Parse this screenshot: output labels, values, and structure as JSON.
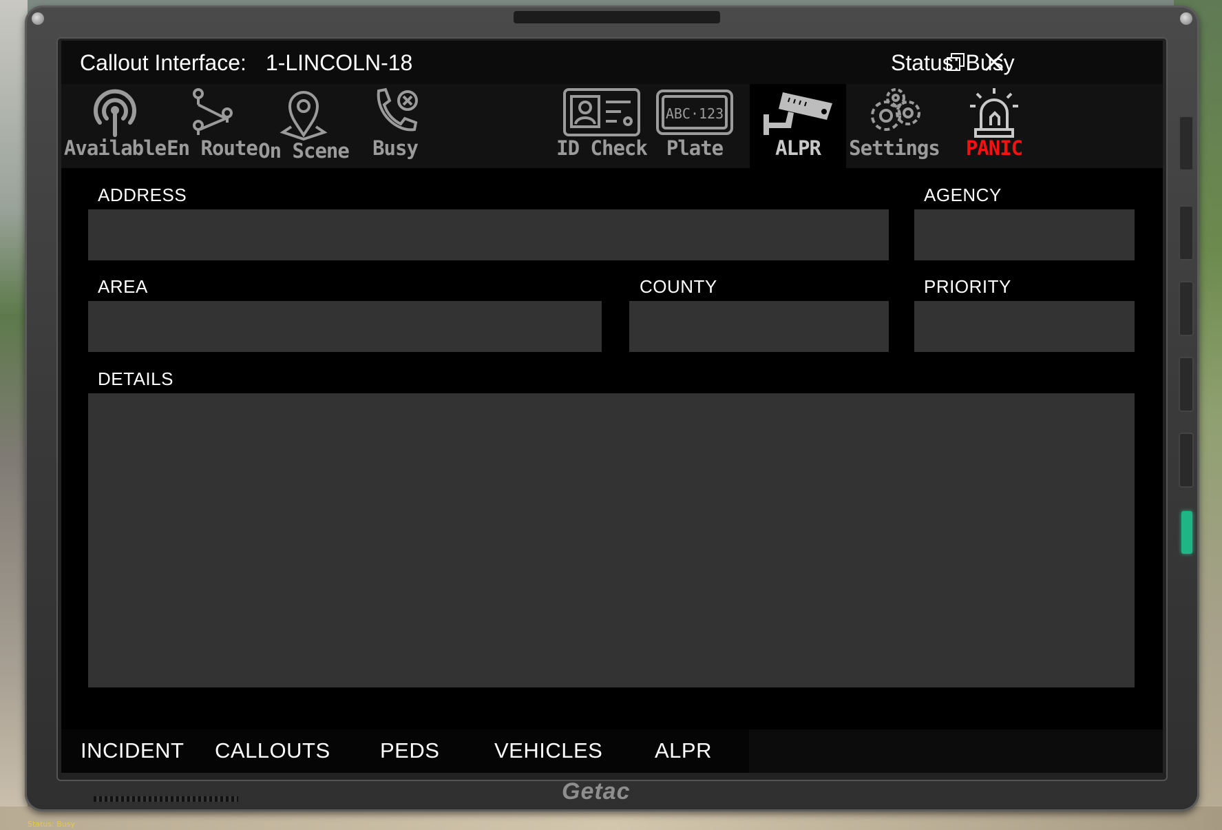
{
  "window": {
    "title": "Callout Interface:",
    "unit": "1-LINCOLN-18",
    "status": "Status: Busy"
  },
  "toolbar": [
    {
      "label": "Available",
      "icon": "broadcast-icon"
    },
    {
      "label": "En Route",
      "icon": "route-icon"
    },
    {
      "label": "On Scene",
      "icon": "map-pin-icon"
    },
    {
      "label": "Busy",
      "icon": "phone-busy-icon"
    },
    {
      "label": "ID Check",
      "icon": "id-card-icon"
    },
    {
      "label": "Plate",
      "icon": "license-plate-icon"
    },
    {
      "label": "ALPR",
      "icon": "security-camera-icon",
      "active": true
    },
    {
      "label": "Settings",
      "icon": "gears-icon"
    },
    {
      "label": "PANIC",
      "icon": "siren-icon",
      "color": "#f21212"
    }
  ],
  "form": {
    "address": {
      "label": "ADDRESS",
      "value": ""
    },
    "agency": {
      "label": "AGENCY",
      "value": ""
    },
    "area": {
      "label": "AREA",
      "value": ""
    },
    "county": {
      "label": "COUNTY",
      "value": ""
    },
    "priority": {
      "label": "PRIORITY",
      "value": ""
    },
    "details": {
      "label": "DETAILS",
      "value": ""
    }
  },
  "tabs": [
    "INCIDENT",
    "CALLOUTS",
    "PEDS",
    "VEHICLES",
    "ALPR"
  ],
  "device": {
    "brand": "Getac",
    "status_overlay": "Status: Busy"
  },
  "colors": {
    "panic": "#f21212",
    "field": "#333333",
    "led": "#1fb585"
  }
}
